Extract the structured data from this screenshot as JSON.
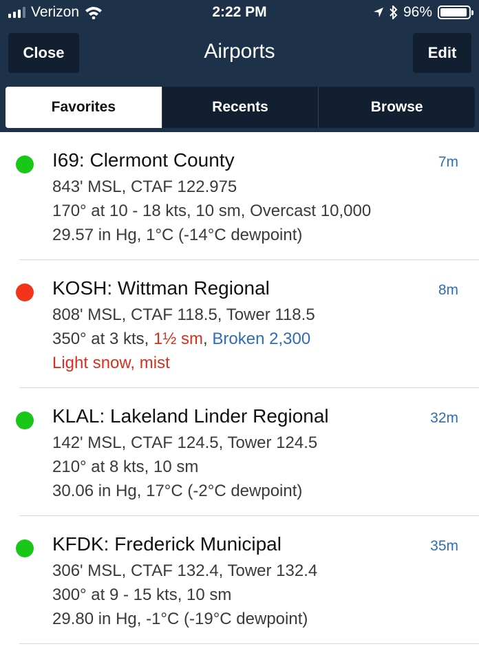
{
  "status_bar": {
    "carrier": "Verizon",
    "time": "2:22 PM",
    "battery": "96%",
    "battery_level": 0.96,
    "signal_bars": 3
  },
  "nav": {
    "title": "Airports",
    "close_label": "Close",
    "edit_label": "Edit"
  },
  "tabs": [
    {
      "label": "Favorites",
      "active": true
    },
    {
      "label": "Recents",
      "active": false
    },
    {
      "label": "Browse",
      "active": false
    }
  ],
  "colors": {
    "green": "#18c718",
    "red": "#f2341a"
  },
  "airports": [
    {
      "name": "I69: Clermont County",
      "age": "7m",
      "status": "green",
      "line1": "843' MSL, CTAF 122.975",
      "line2": "170° at 10 - 18 kts, 10 sm, Overcast 10,000",
      "line3": "29.57 in Hg, 1°C (-14°C dewpoint)"
    },
    {
      "name": "KOSH: Wittman Regional",
      "age": "8m",
      "status": "red",
      "line1": "808' MSL, CTAF 118.5, Tower 118.5",
      "line2_a": "350° at 3 kts,",
      "line2_b": "1½ sm",
      "line2_c": ",",
      "line2_d": "Broken 2,300",
      "line3": "Light snow, mist"
    },
    {
      "name": "KLAL: Lakeland Linder Regional",
      "age": "32m",
      "status": "green",
      "line1": "142' MSL, CTAF 124.5, Tower 124.5",
      "line2": "210° at 8 kts, 10 sm",
      "line3": "30.06 in Hg, 17°C (-2°C dewpoint)"
    },
    {
      "name": "KFDK: Frederick Municipal",
      "age": "35m",
      "status": "green",
      "line1": "306' MSL, CTAF 132.4, Tower 132.4",
      "line2": "300° at 9 - 15 kts, 10 sm",
      "line3": "29.80 in Hg, -1°C (-19°C dewpoint)"
    }
  ]
}
